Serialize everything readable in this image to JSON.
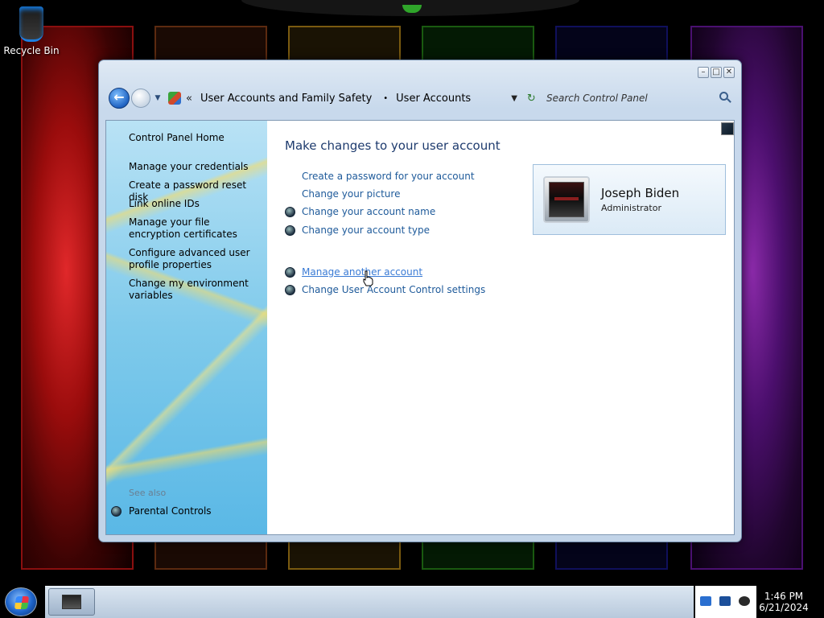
{
  "desktop": {
    "recycle_bin_label": "Recycle Bin"
  },
  "window": {
    "caption_buttons": {
      "minimize": "–",
      "maximize": "□",
      "close": "✕"
    },
    "address_bar": {
      "breadcrumb_1": "User Accounts and Family Safety",
      "separator": "•",
      "breadcrumb_2": "User Accounts",
      "overflow": "«"
    },
    "search": {
      "placeholder": "Search Control Panel"
    },
    "sidebar": {
      "home": "Control Panel Home",
      "links": [
        "Manage your credentials",
        "Create a password reset disk",
        "Link online IDs",
        "Manage your file encryption certificates",
        "Configure advanced user profile properties",
        "Change my environment variables"
      ],
      "see_also": "See also",
      "parental_controls": "Parental Controls"
    },
    "main": {
      "title": "Make changes to your user account",
      "tasks": [
        "Create a password for your account",
        "Change your picture",
        "Change your account name",
        "Change your account type"
      ],
      "tasks_2": [
        "Manage another account",
        "Change User Account Control settings"
      ]
    },
    "user": {
      "name": "Joseph Biden",
      "role": "Administrator"
    }
  },
  "taskbar": {
    "time": "1:46 PM",
    "date": "6/21/2024"
  },
  "colors": {
    "link": "#1e5a9a",
    "title": "#1e3b6e",
    "hover_link": "#3a7bd5"
  }
}
